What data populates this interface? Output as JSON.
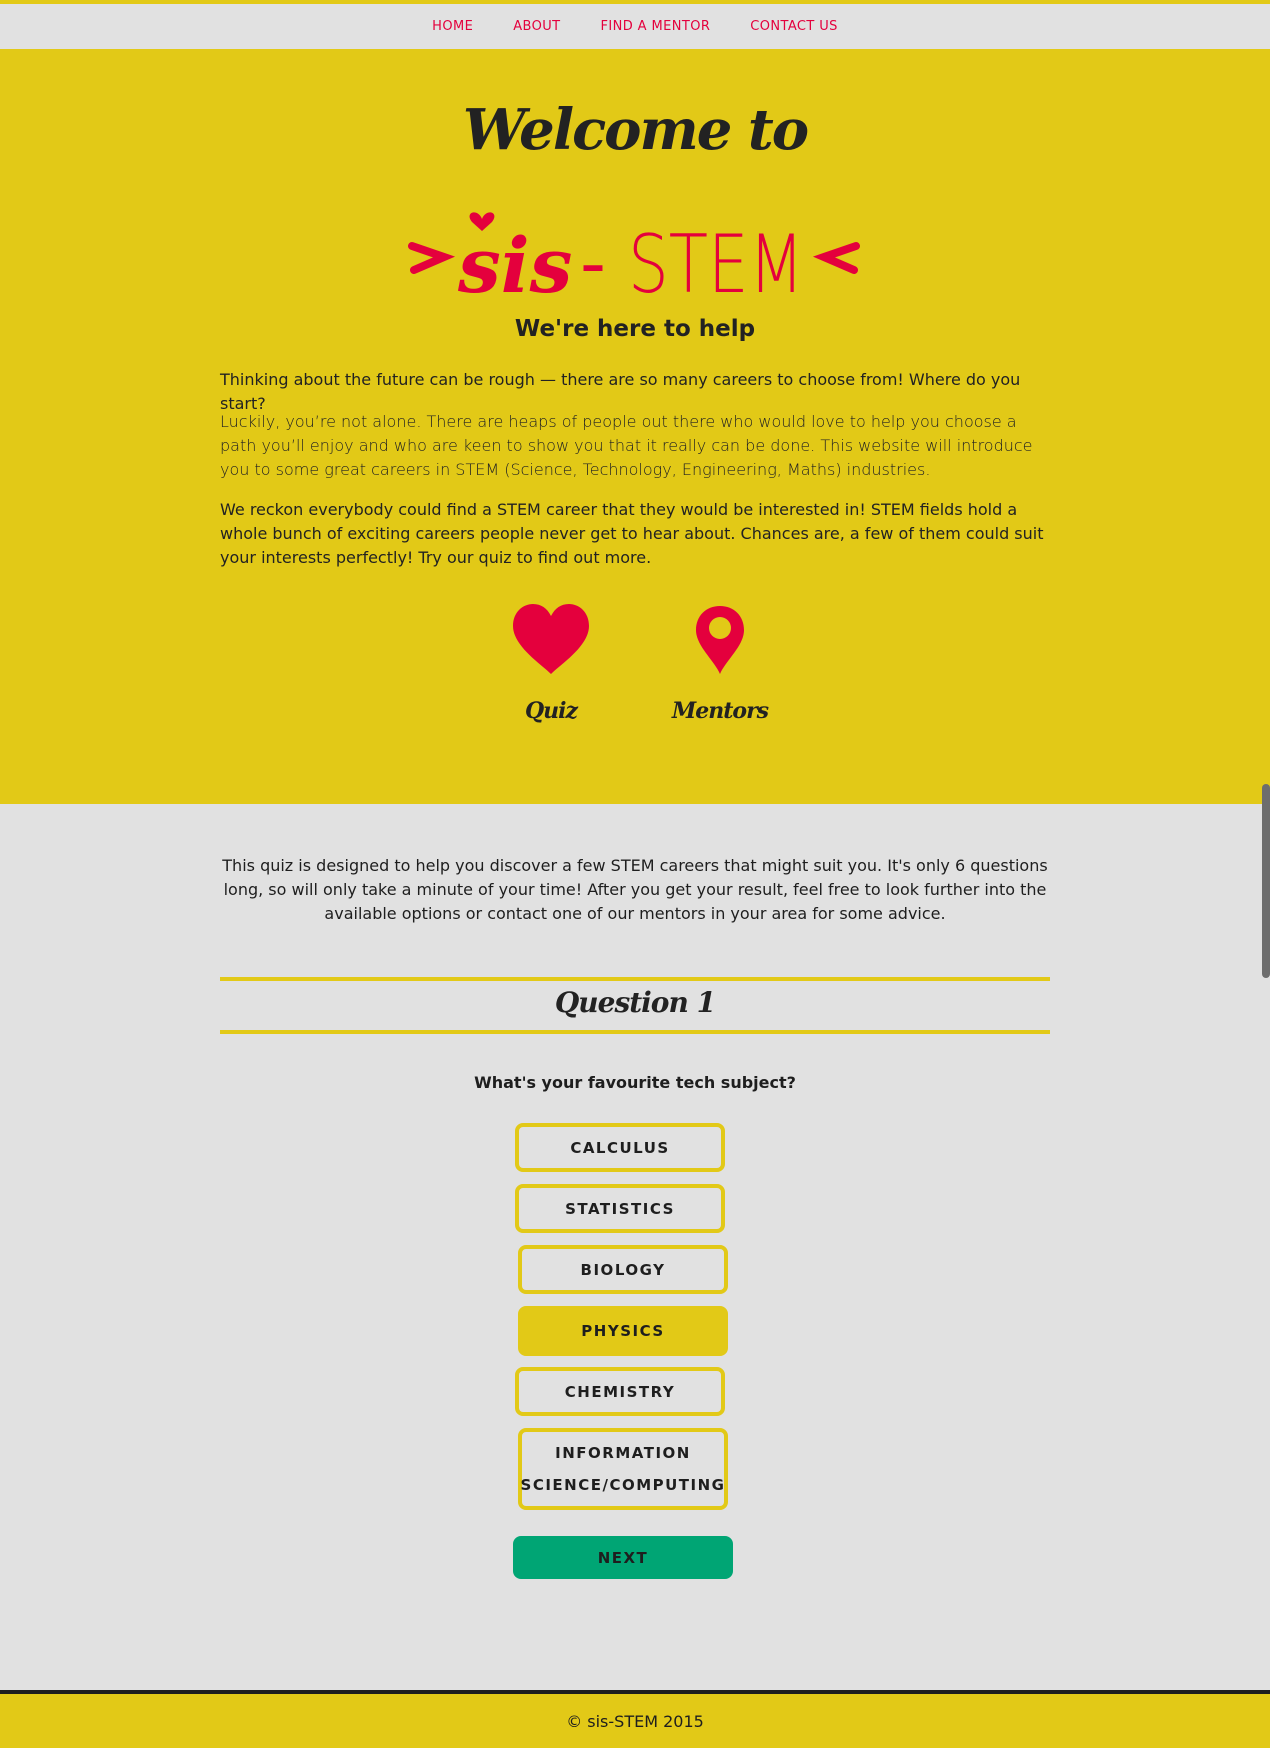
{
  "nav": {
    "items": [
      {
        "label": "HOME"
      },
      {
        "label": "ABOUT"
      },
      {
        "label": "FIND A MENTOR"
      },
      {
        "label": "CONTACT US"
      }
    ]
  },
  "hero": {
    "welcome": "Welcome to",
    "logo_sis": "sis",
    "logo_dash": "-",
    "logo_stem": "STEM",
    "heading": "We're here to help",
    "paragraphs": [
      "Thinking about the future can be rough — there are so many careers to choose from! Where do you start?",
      "Luckily, you’re not alone. There are heaps of people out there who would love to help you choose a path you’ll enjoy and who are keen to show you that it really can be done. This website will introduce you to some great careers in STEM (Science, Technology, Engineering, Maths) industries.",
      "We reckon everybody could find a STEM career that they would be interested in! STEM fields hold a whole bunch of exciting careers people never get to hear about. Chances are, a few of them could suit your interests perfectly! Try our quiz to find out more."
    ],
    "links": [
      {
        "label": "Quiz",
        "icon": "heart-icon"
      },
      {
        "label": "Mentors",
        "icon": "map-pin-icon"
      }
    ]
  },
  "quiz": {
    "intro": "This quiz is designed to help you discover a few STEM careers that might suit you. It's only 6 questions long, so will only take a minute of your time! After you get your result, feel free to look further into the available options or contact one of our mentors in your area for some advice.",
    "question_title": "Question 1",
    "question": "What's your favourite tech subject?",
    "options": [
      {
        "label": "CALCULUS",
        "selected": false
      },
      {
        "label": "STATISTICS",
        "selected": false
      },
      {
        "label": "BIOLOGY",
        "selected": false
      },
      {
        "label": "PHYSICS",
        "selected": true
      },
      {
        "label": "CHEMISTRY",
        "selected": false
      },
      {
        "label": "INFORMATION SCIENCE/COMPUTING",
        "selected": false
      }
    ],
    "next_label": "NEXT"
  },
  "footer": {
    "text": "© sis-STEM 2015"
  },
  "colors": {
    "accent_yellow": "#e2c917",
    "brand_red": "#e4003d",
    "next_green": "#00a574",
    "background": "#e1e1e1"
  }
}
